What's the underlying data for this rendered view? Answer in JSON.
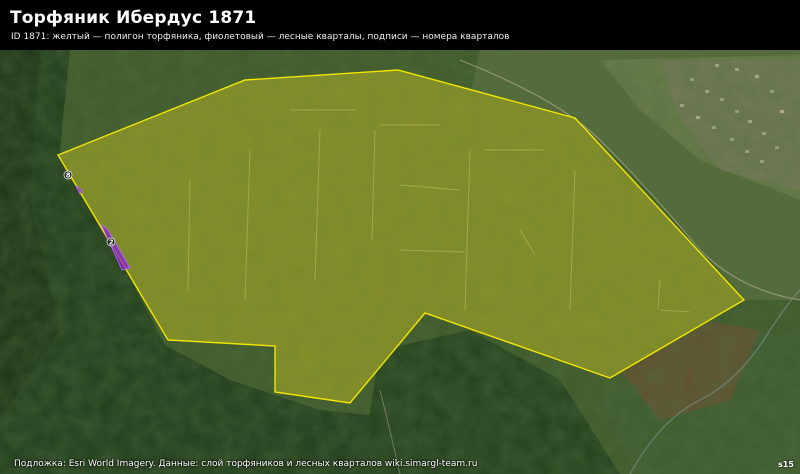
{
  "title": "Торфяник Ибердус 1871",
  "subtitle": "ID 1871: желтый — полигон торфяника, фиолетовый — лесные кварталы, подписи — номера кварталов",
  "footer": "Подложка: Esri World Imagery. Данные: слой торфяников и лесных кварталов wiki.simargl-team.ru",
  "logo": "s15",
  "colors": {
    "peat_outline": "#f2e600",
    "peat_fill": "#c8c000",
    "forest_quarter": "#8a1fd0",
    "title_bg": "#000000"
  },
  "forest_quarters": [
    {
      "label": "8"
    },
    {
      "label": "2"
    }
  ]
}
